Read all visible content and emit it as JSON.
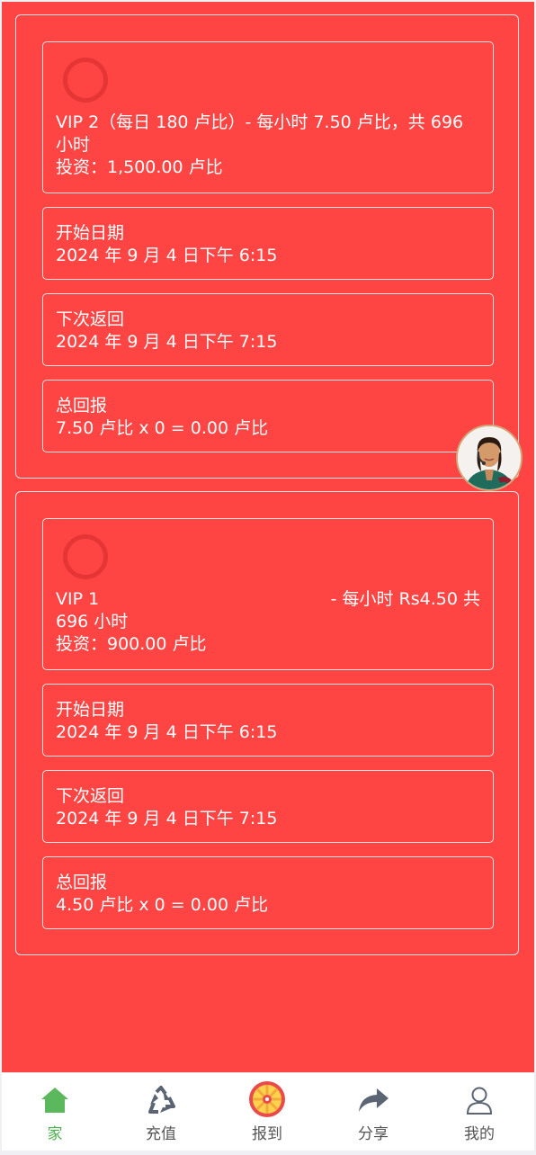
{
  "plans": [
    {
      "title": "VIP 2（每日 180 卢比）- 每小时 7.50 卢比，共 696",
      "title_cont": "小时",
      "investment": "投资：1,500.00 卢比",
      "start_label": "开始日期",
      "start_value": "2024 年 9 月 4 日下午 6:15",
      "next_label": "下次返回",
      "next_value": "2024 年 9 月 4 日下午 7:15",
      "total_label": "总回报",
      "total_value": "7.50 卢比 x 0 = 0.00 卢比"
    },
    {
      "title_left": "VIP 1",
      "title_right": "- 每小时 Rs4.50 共",
      "title_cont": "696 小时",
      "investment": "投资：900.00 卢比",
      "start_label": "开始日期",
      "start_value": "2024 年 9 月 4 日下午 6:15",
      "next_label": "下次返回",
      "next_value": "2024 年 9 月 4 日下午 7:15",
      "total_label": "总回报",
      "total_value": "4.50 卢比 x 0 = 0.00 卢比"
    }
  ],
  "tabbar": [
    {
      "label": "家",
      "icon": "home-icon",
      "active": true
    },
    {
      "label": "充值",
      "icon": "recycle-icon"
    },
    {
      "label": "报到",
      "icon": "lucky-wheel-icon"
    },
    {
      "label": "分享",
      "icon": "share-arrow-icon"
    },
    {
      "label": "我的",
      "icon": "user-icon"
    }
  ],
  "colors": {
    "background": "#ff4444",
    "active_tab": "#4caf50",
    "tab_icon": "#5a6473"
  }
}
